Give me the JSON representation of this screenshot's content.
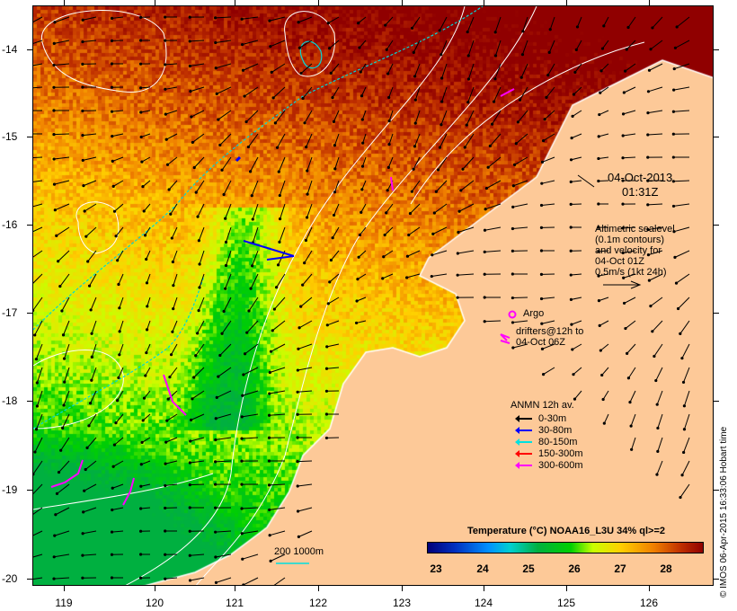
{
  "map": {
    "date": "04-Oct-2013",
    "time": "01:31Z",
    "altimetry_note": [
      "Altimetric sealevel",
      "(0.1m contours)",
      "and velocity for",
      "04-Oct 01Z",
      "0.5m/s (1kt 24h)"
    ],
    "argo_label": "Argo",
    "drifters_label": [
      "drifters@12h to",
      "04-Oct 06Z"
    ],
    "anmn_title": "ANMN 12h av.",
    "anmn_legend": [
      {
        "label": "0-30m",
        "color": "#000000"
      },
      {
        "label": "30-80m",
        "color": "#0000ff"
      },
      {
        "label": "80-150m",
        "color": "#00e0e0"
      },
      {
        "label": "150-300m",
        "color": "#ff0000"
      },
      {
        "label": "300-600m",
        "color": "#ff00ff"
      }
    ],
    "isobath_label": "200  1000m",
    "colorbar_title": "Temperature (°C) NOAA16_L3U 34% ql>=2",
    "colorbar_ticks": [
      "23",
      "24",
      "25",
      "26",
      "27",
      "28"
    ],
    "lon_ticks": [
      "119",
      "120",
      "121",
      "122",
      "123",
      "124",
      "125",
      "126"
    ],
    "lat_ticks": [
      "-14",
      "-15",
      "-16",
      "-17",
      "-18",
      "-19",
      "-20"
    ],
    "credit": "© IMOS 06-Apr-2015 16:33:06 Hobart time",
    "colors": {
      "land": "#fdc998",
      "argo": "#ff00ff",
      "contour": "#ffffff",
      "isobath": "#00e0e0"
    }
  }
}
